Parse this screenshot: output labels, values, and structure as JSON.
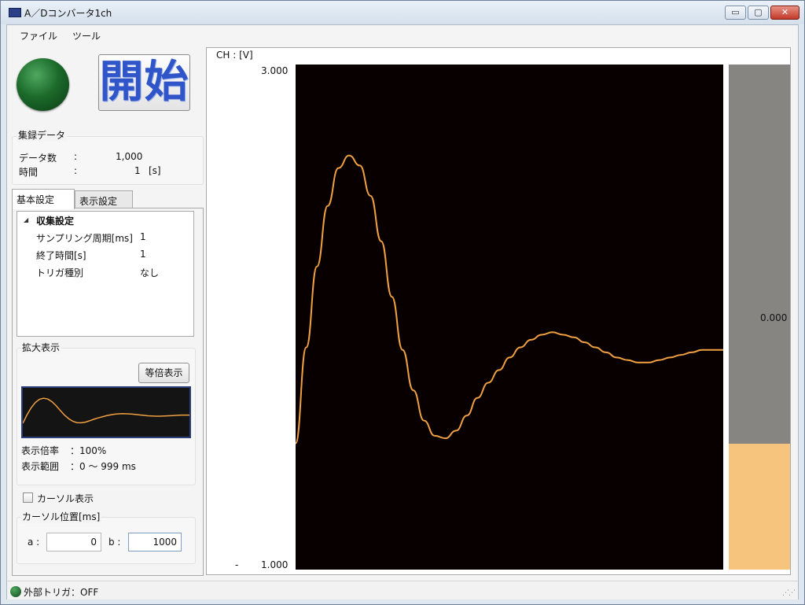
{
  "window": {
    "title": "A／Dコンバータ1ch",
    "minimize_glyph": "▭",
    "maximize_glyph": "▢",
    "close_glyph": "✕"
  },
  "menu": [
    "ファイル",
    "ツール"
  ],
  "start_button": "開始",
  "collected": {
    "title": "集録データ",
    "rows": [
      {
        "label": "データ数",
        "sep": ":",
        "value": "1,000",
        "unit": ""
      },
      {
        "label": "時間",
        "sep": ":",
        "value": "1",
        "unit": "[s]"
      }
    ]
  },
  "tabs": [
    "基本設定",
    "表示設定"
  ],
  "settings": {
    "group": "収集設定",
    "expander_glyph": "◢",
    "items": [
      {
        "label": "サンプリング周期[ms]",
        "value": "1"
      },
      {
        "label": "終了時間[s]",
        "value": "1"
      },
      {
        "label": "トリガ種別",
        "value": "なし"
      }
    ]
  },
  "zoom": {
    "title": "拡大表示",
    "button": "等倍表示",
    "rate_label": "表示倍率",
    "rate_value": "：100%",
    "range_label": "表示範囲",
    "range_value": "：0 ～ 999 ms"
  },
  "cursor": {
    "show_label": "カーソル表示",
    "show_checked": false,
    "position_title": "カーソル位置[ms]",
    "a_label": "a :",
    "a_value": "0",
    "b_label": "b :",
    "b_value": "1000"
  },
  "plot": {
    "channel_label": "CH : [V]",
    "meter_value": "0.000",
    "line_color": "#f0a040"
  },
  "status": {
    "text": "外部トリガ：OFF"
  },
  "chart_data": {
    "type": "line",
    "ylabel": "CH : [V]",
    "ylim": [
      1.0,
      3.0
    ],
    "yticks": [
      "3.000",
      "1.000"
    ],
    "x_unit": "ms",
    "xlim": [
      0,
      999
    ],
    "series": [
      {
        "x": [
          0,
          25,
          50,
          75,
          100,
          125,
          150,
          175,
          200,
          225,
          250,
          275,
          300,
          325,
          350,
          375,
          400,
          425,
          450,
          475,
          500,
          525,
          550,
          575,
          600,
          625,
          650,
          675,
          700,
          725,
          750,
          775,
          800,
          825,
          850,
          875,
          900,
          925,
          950,
          975,
          999
        ],
        "values": [
          1.5,
          1.88,
          2.2,
          2.44,
          2.59,
          2.64,
          2.6,
          2.48,
          2.3,
          2.08,
          1.87,
          1.71,
          1.59,
          1.53,
          1.52,
          1.55,
          1.61,
          1.68,
          1.74,
          1.79,
          1.84,
          1.88,
          1.91,
          1.93,
          1.94,
          1.93,
          1.92,
          1.9,
          1.88,
          1.86,
          1.84,
          1.83,
          1.82,
          1.82,
          1.83,
          1.84,
          1.85,
          1.86,
          1.87,
          1.87,
          1.87
        ]
      }
    ],
    "grid": false
  },
  "preview_data": {
    "values": [
      1.5,
      1.88,
      2.2,
      2.44,
      2.59,
      2.64,
      2.6,
      2.48,
      2.3,
      2.08,
      1.87,
      1.71,
      1.59,
      1.53,
      1.52,
      1.55,
      1.61,
      1.68,
      1.74,
      1.79,
      1.84,
      1.88,
      1.91,
      1.93,
      1.94,
      1.93,
      1.92,
      1.9,
      1.88,
      1.86,
      1.84,
      1.83,
      1.82,
      1.82,
      1.83,
      1.84,
      1.85,
      1.86,
      1.87,
      1.87,
      1.87
    ]
  },
  "meter": {
    "fill_fraction": 0.25
  }
}
